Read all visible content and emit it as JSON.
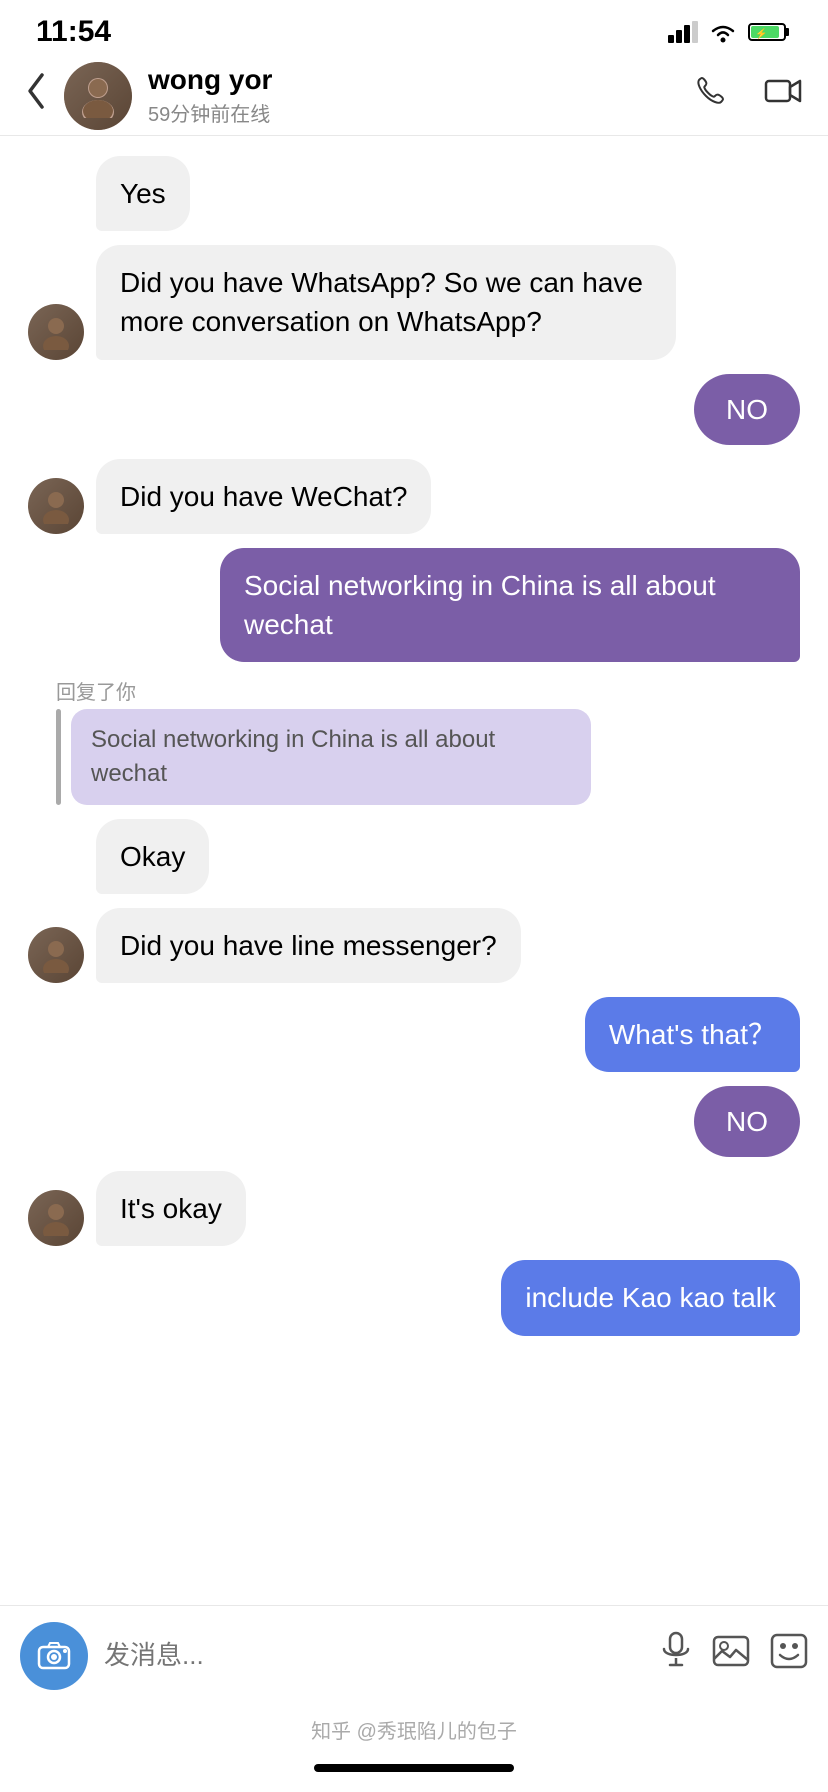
{
  "statusBar": {
    "time": "11:54",
    "signal": "▂▄▆",
    "wifi": "wifi",
    "battery": "⚡"
  },
  "header": {
    "backLabel": "‹",
    "contactName": "wong yor",
    "contactStatus": "59分钟前在线",
    "callLabel": "📞",
    "videoLabel": "📹"
  },
  "messages": [
    {
      "id": 1,
      "type": "received",
      "text": "Yes",
      "showAvatar": false
    },
    {
      "id": 2,
      "type": "received",
      "text": "Did you have WhatsApp? So we can have more conversation on WhatsApp?",
      "showAvatar": true
    },
    {
      "id": 3,
      "type": "sent",
      "text": "NO",
      "style": "small"
    },
    {
      "id": 4,
      "type": "received",
      "text": "Did you have WeChat?",
      "showAvatar": true
    },
    {
      "id": 5,
      "type": "sent",
      "text": "Social networking in China is all about wechat",
      "style": "large"
    },
    {
      "id": 6,
      "type": "reply-context",
      "label": "回复了你",
      "quotedText": "Social networking in China is all about wechat"
    },
    {
      "id": 7,
      "type": "received",
      "text": "Okay",
      "showAvatar": false
    },
    {
      "id": 8,
      "type": "received",
      "text": "Did you have line messenger?",
      "showAvatar": true
    },
    {
      "id": 9,
      "type": "sent",
      "text": "What's that？",
      "style": "large-blue"
    },
    {
      "id": 10,
      "type": "sent",
      "text": "NO",
      "style": "small"
    },
    {
      "id": 11,
      "type": "received",
      "text": "It's okay",
      "showAvatar": true
    },
    {
      "id": 12,
      "type": "sent",
      "text": "include Kao kao talk",
      "style": "large-blue"
    }
  ],
  "inputBar": {
    "placeholder": "发消息...",
    "cameraIcon": "📷",
    "micIcon": "🎤",
    "imageIcon": "🖼",
    "stickerIcon": "😊"
  },
  "watermark": {
    "text": "知乎 @秀珉陷儿的包子"
  }
}
